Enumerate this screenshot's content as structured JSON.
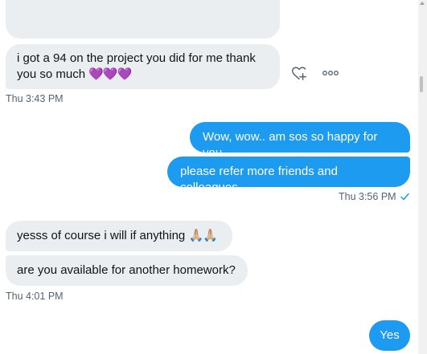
{
  "messages": [
    {
      "id": "m1",
      "text": "i got a 94 on the project you did for me thank",
      "text2": "you so much",
      "hearts": "💜💜💜"
    },
    {
      "id": "ts1",
      "text": "Thu 3:43 PM"
    },
    {
      "id": "m2",
      "text": "Wow, wow.. am sos so happy for you"
    },
    {
      "id": "m3",
      "text": "please refer more friends and colleagues."
    },
    {
      "id": "ts2",
      "text": "Thu 3:56 PM",
      "status_icon": "check-icon"
    },
    {
      "id": "m4",
      "text": "yesss of course i will if anything",
      "emoji": "🙏🏼🙏🏼"
    },
    {
      "id": "m5",
      "text": "are you available for another homework?"
    },
    {
      "id": "ts3",
      "text": "Thu 4:01 PM"
    },
    {
      "id": "m6",
      "text": "Yes"
    }
  ],
  "colors": {
    "incoming": "#ebeef0",
    "outgoing": "#1d9bf0",
    "timestamp": "#536471"
  },
  "icons": {
    "react": "add-reaction-icon",
    "more": "more-options-icon"
  }
}
